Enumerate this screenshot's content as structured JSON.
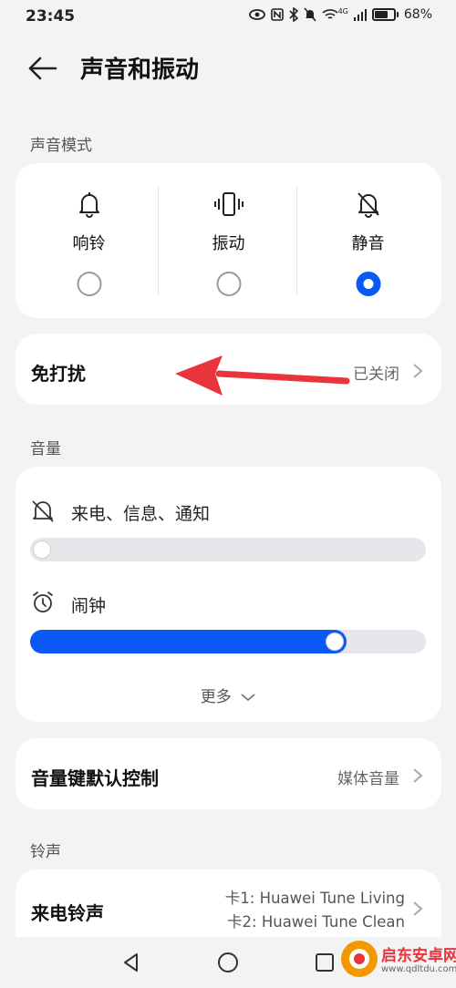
{
  "status_bar": {
    "time": "23:45",
    "network": "4G",
    "battery": "68%",
    "battery_level": 0.68
  },
  "header": {
    "back_icon": "back-arrow-icon",
    "title": "声音和振动"
  },
  "sound_mode": {
    "section_label": "声音模式",
    "options": [
      {
        "label": "响铃",
        "icon": "bell-icon",
        "selected": false
      },
      {
        "label": "振动",
        "icon": "vibrate-icon",
        "selected": false
      },
      {
        "label": "静音",
        "icon": "bell-off-icon",
        "selected": true
      }
    ]
  },
  "dnd": {
    "label": "免打扰",
    "value": "已关闭"
  },
  "volume": {
    "section_label": "音量",
    "sliders": [
      {
        "label": "来电、信息、通知",
        "icon": "bell-off-icon",
        "level": 0.0
      },
      {
        "label": "闹钟",
        "icon": "alarm-clock-icon",
        "level": 0.8
      },
      {}
    ],
    "more_label": "更多"
  },
  "volume_key": {
    "label": "音量键默认控制",
    "value": "媒体音量"
  },
  "ringtone": {
    "section_label": "铃声",
    "label": "来电铃声",
    "sim1": "卡1: Huawei Tune Living",
    "sim2": "卡2: Huawei Tune Clean"
  },
  "watermark": {
    "name": "启东安卓网",
    "url": "www.qdltdu.com"
  },
  "colors": {
    "accent": "#0a59f7",
    "annotation_arrow": "#e8343a"
  }
}
